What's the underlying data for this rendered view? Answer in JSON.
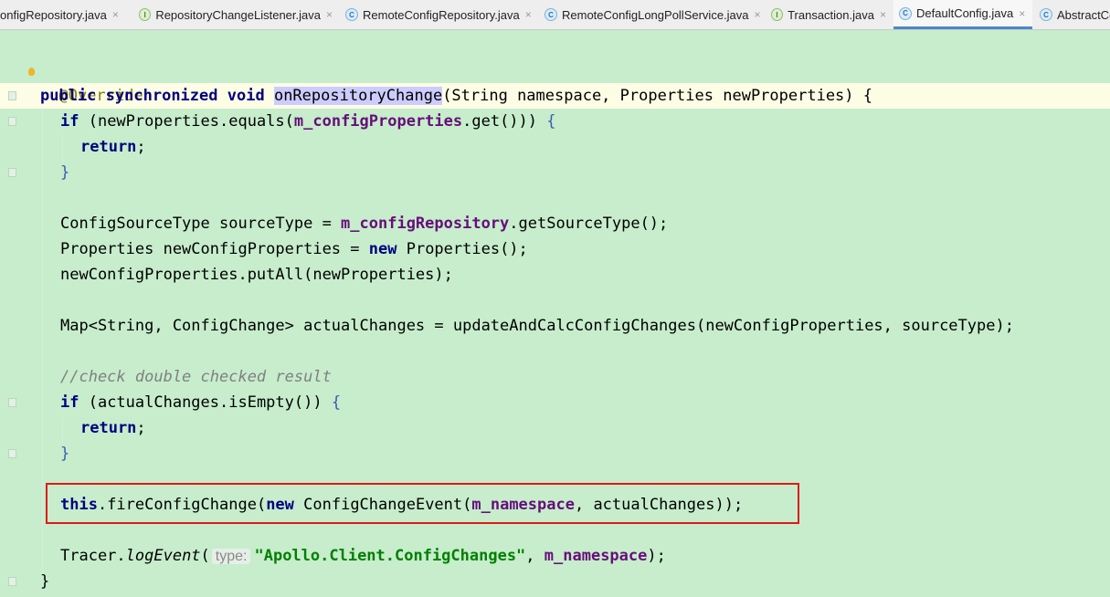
{
  "tabs": [
    {
      "label": "onfigRepository.java",
      "icon": "",
      "active": false
    },
    {
      "label": "RepositoryChangeListener.java",
      "icon": "I",
      "active": false
    },
    {
      "label": "RemoteConfigRepository.java",
      "icon": "C",
      "active": false
    },
    {
      "label": "RemoteConfigLongPollService.java",
      "icon": "C",
      "active": false
    },
    {
      "label": "Transaction.java",
      "icon": "I",
      "active": false
    },
    {
      "label": "DefaultConfig.java",
      "icon": "C",
      "active": true
    },
    {
      "label": "AbstractCo",
      "icon": "C",
      "active": false
    }
  ],
  "close_glyph": "×",
  "code": {
    "annotation": "@Override",
    "method_sig": {
      "kw1": "public",
      "kw2": "synchronized",
      "kw3": "void",
      "name": "onRepositoryChange",
      "params": "(String namespace, Properties newProperties) ",
      "brace": "{"
    },
    "if1": {
      "kw": "if",
      "pre": " (newProperties.equals(",
      "field": "m_configProperties",
      "post": ".get())) ",
      "brace": "{"
    },
    "return1": "return",
    "semicolon": ";",
    "close1": "}",
    "line_source_type": {
      "pre": "ConfigSourceType sourceType = ",
      "field": "m_configRepository",
      "post": ".getSourceType();"
    },
    "line_new_props": {
      "pre": "Properties newConfigProperties = ",
      "kw": "new",
      "post": " Properties();"
    },
    "line_putall": "newConfigProperties.putAll(newProperties);",
    "line_map": "Map<String, ConfigChange> actualChanges = updateAndCalcConfigChanges(newConfigProperties, sourceType);",
    "comment": "//check double checked result",
    "if2": {
      "kw": "if",
      "pre": " (actualChanges.isEmpty()) ",
      "brace": "{"
    },
    "return2": "return",
    "close2": "}",
    "fire": {
      "kw_this": "this",
      "mid": ".fireConfigChange(",
      "kw_new": "new",
      "post1": " ConfigChangeEvent(",
      "field": "m_namespace",
      "post2": ", actualChanges));"
    },
    "tracer": {
      "pre": "Tracer.",
      "method": "logEvent",
      "paren": "(",
      "hint": "type:",
      "str": "\"Apollo.Client.ConfigChanges\"",
      "sep": ", ",
      "field": "m_namespace",
      "post": ");"
    },
    "close_method": "}"
  }
}
